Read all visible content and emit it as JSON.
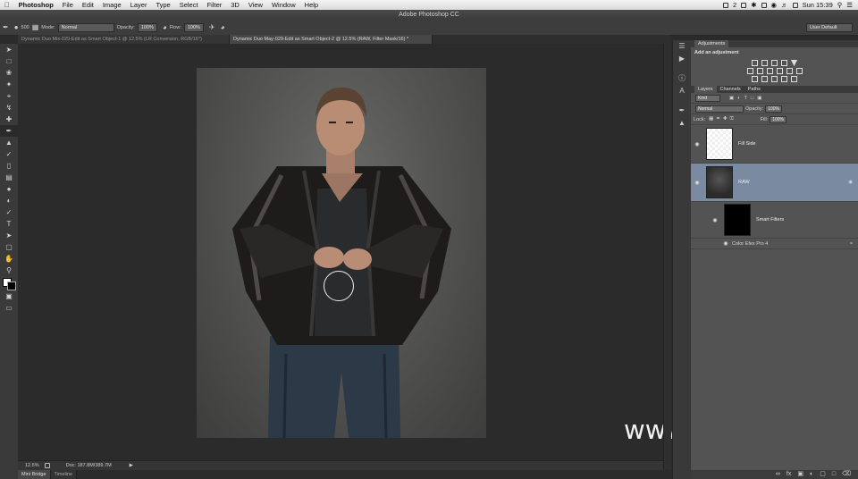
{
  "menubar": {
    "app": "Photoshop",
    "items": [
      "File",
      "Edit",
      "Image",
      "Layer",
      "Type",
      "Select",
      "Filter",
      "3D",
      "View",
      "Window",
      "Help"
    ],
    "badge": "2",
    "clock": "Sun 15:39"
  },
  "window_title": "Adobe Photoshop CC",
  "options": {
    "brush_size": "500",
    "mode_label": "Mode:",
    "mode_value": "Normal",
    "opacity_label": "Opacity:",
    "opacity_value": "100%",
    "flow_label": "Flow:",
    "flow_value": "100%",
    "workspace": "User Default"
  },
  "doc_tabs": [
    {
      "label": "Dynamic Duo Mix-029-Edit as Smart Object-1 @ 12.5% (LR Conversion, RGB/16*)"
    },
    {
      "label": "Dynamic Duo May-029-Edit as Smart Object-2 @ 12.5% (RAW, Filter Mask/16) *"
    }
  ],
  "status": {
    "zoom": "12.5%",
    "doc_info": "Doc: 187.8M/389.7M"
  },
  "bottom_tabs": [
    "Mini Bridge",
    "Timeline"
  ],
  "watermark": "www.hunls.com",
  "panels": {
    "adjustments_tab": "Adjustments",
    "add_adjustment": "Add an adjustment",
    "layer_tabs": [
      "Layers",
      "Channels",
      "Paths"
    ],
    "kind": "Kind",
    "blend_mode": "Normal",
    "opacity_label": "Opacity:",
    "opacity_value": "100%",
    "lock_label": "Lock:",
    "fill_label": "Fill:",
    "fill_value": "100%",
    "layers": [
      {
        "name": "Fill Side"
      },
      {
        "name": "RAW"
      }
    ],
    "smart_filters": "Smart Filters",
    "filter_name": "Color Efex Pro 4"
  }
}
